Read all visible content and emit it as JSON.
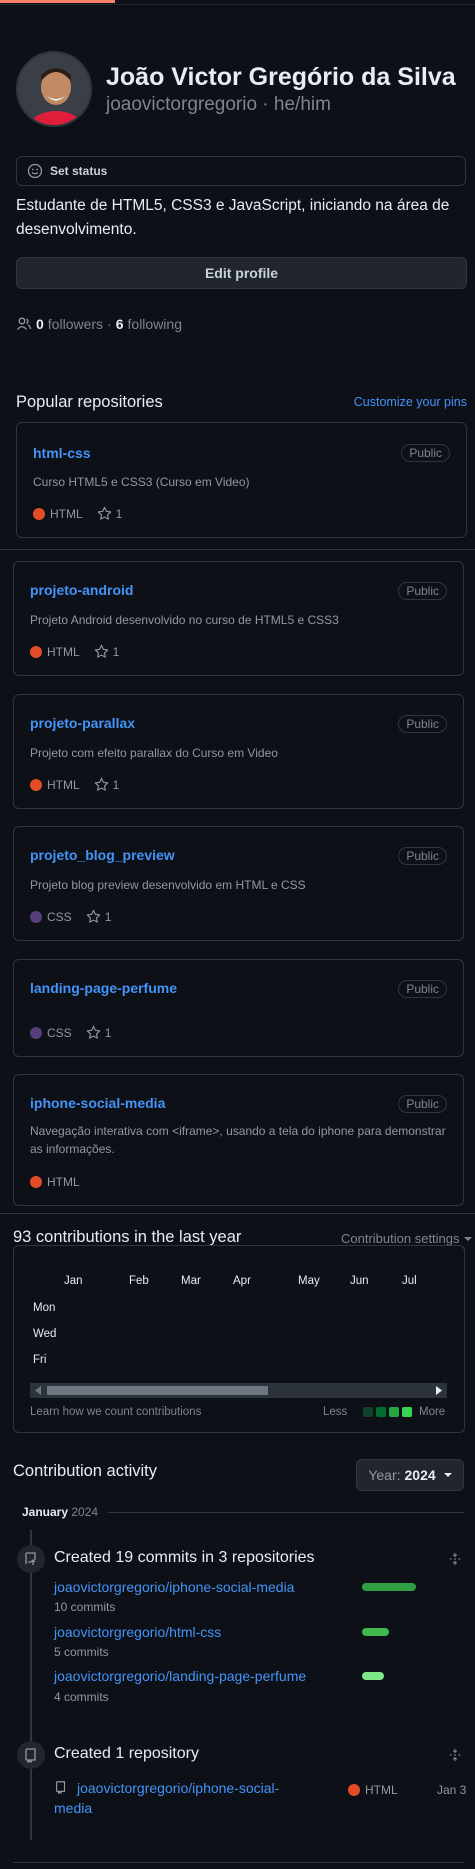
{
  "profile": {
    "name": "João Victor Gregório da Silva",
    "login_line": "joaovictorgregorio · he/him",
    "set_status": "Set status",
    "bio": "Estudante de HTML5, CSS3 e JavaScript, iniciando na área de desenvolvimento.",
    "edit_profile": "Edit profile",
    "followers_count": "0",
    "followers_label": "followers",
    "sep": "·",
    "following_count": "6",
    "following_label": "following"
  },
  "popular": {
    "title": "Popular repositories",
    "customize": "Customize your pins",
    "repos": [
      {
        "name": "html-css",
        "badge": "Public",
        "desc": "Curso HTML5 e CSS3 (Curso em Video)",
        "lang": "HTML",
        "lang_color": "#e34c26",
        "stars": "1"
      },
      {
        "name": "projeto-android",
        "badge": "Public",
        "desc": "Projeto Android desenvolvido no curso de HTML5 e CSS3",
        "lang": "HTML",
        "lang_color": "#e34c26",
        "stars": "1"
      },
      {
        "name": "projeto-parallax",
        "badge": "Public",
        "desc": "Projeto com efeito parallax do Curso em Video",
        "lang": "HTML",
        "lang_color": "#e34c26",
        "stars": "1"
      },
      {
        "name": "projeto_blog_preview",
        "badge": "Public",
        "desc": "Projeto blog preview desenvolvido em HTML e CSS",
        "lang": "CSS",
        "lang_color": "#563d7c",
        "stars": "1"
      },
      {
        "name": "landing-page-perfume",
        "badge": "Public",
        "desc": "",
        "lang": "CSS",
        "lang_color": "#563d7c",
        "stars": "1"
      },
      {
        "name": "iphone-social-media",
        "badge": "Public",
        "desc": "Navegação interativa com <iframe>, usando a tela do iphone para demonstrar as informações.",
        "lang": "HTML",
        "lang_color": "#e34c26",
        "stars": ""
      }
    ]
  },
  "contrib": {
    "title": "93 contributions in the last year",
    "settings": "Contribution settings",
    "months": [
      "Jan",
      "Feb",
      "Mar",
      "Apr",
      "May",
      "Jun",
      "Jul"
    ],
    "days": [
      "Mon",
      "Wed",
      "Fri"
    ],
    "learn": "Learn how we count contributions",
    "less": "Less",
    "more": "More",
    "legend_colors": [
      "#0e4429",
      "#006d32",
      "#26a641",
      "#39d353"
    ]
  },
  "activity": {
    "title": "Contribution activity",
    "year_label": "Year:",
    "year_value": "2024",
    "month": "January",
    "month_year": "2024",
    "commits_title": "Created 19 commits in 3 repositories",
    "commit_repos": [
      {
        "name": "joaovictorgregorio/iphone-social-media",
        "count": "10 commits",
        "share": 10,
        "color": "#2ea043"
      },
      {
        "name": "joaovictorgregorio/html-css",
        "count": "5 commits",
        "share": 5,
        "color": "#3fb950"
      },
      {
        "name": "joaovictorgregorio/landing-page-perfume",
        "count": "4 commits",
        "share": 4,
        "color": "#7ee787"
      }
    ],
    "created_title": "Created 1 repository",
    "created_repo": "joaovictorgregorio/iphone-social-media",
    "created_lang": "HTML",
    "created_lang_color": "#e34c26",
    "created_date": "Jan 3"
  }
}
